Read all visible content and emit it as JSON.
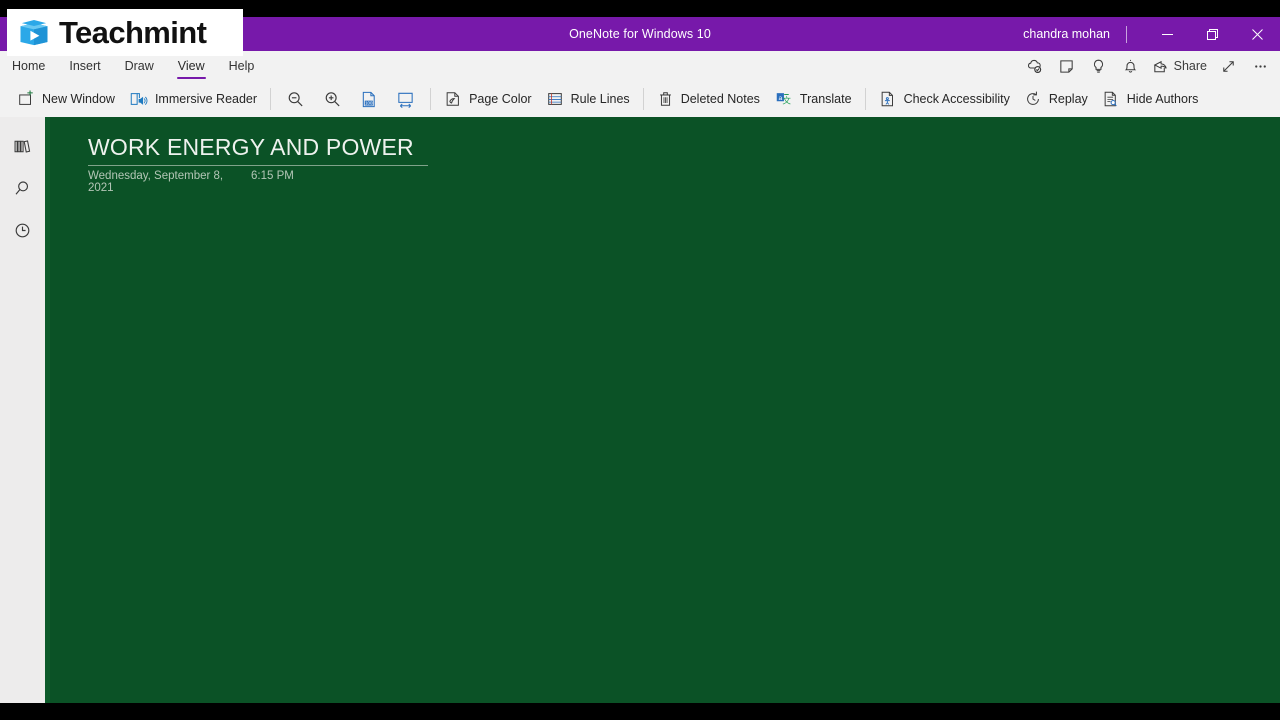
{
  "window": {
    "title": "OneNote for Windows 10",
    "account": "chandra mohan",
    "controls": [
      {
        "name": "minimize-button",
        "label": "Minimize"
      },
      {
        "name": "restore-button",
        "label": "Restore Down"
      },
      {
        "name": "close-button",
        "label": "Close"
      }
    ]
  },
  "watermark": {
    "brand": "Teachmint",
    "logo_icon": "open-book-play-icon",
    "logo_color": "#2BA8E8"
  },
  "ribbon": {
    "tabs": [
      {
        "label": "Home",
        "active": false
      },
      {
        "label": "Insert",
        "active": false
      },
      {
        "label": "Draw",
        "active": false
      },
      {
        "label": "View",
        "active": true
      },
      {
        "label": "Help",
        "active": false
      }
    ],
    "active_tab": "View",
    "accent_color": "#7719AA",
    "quick_actions": [
      {
        "label": "",
        "icon": "cloud-sync-icon"
      },
      {
        "label": "",
        "icon": "sticky-note-icon"
      },
      {
        "label": "",
        "icon": "lightbulb-icon"
      },
      {
        "label": "",
        "icon": "bell-icon"
      },
      {
        "label": "Share",
        "icon": "share-icon"
      },
      {
        "label": "",
        "icon": "expand-arrows-icon"
      },
      {
        "label": "",
        "icon": "ellipsis-icon"
      }
    ],
    "share_label": "Share",
    "tools": [
      {
        "label": "New Window",
        "icon": "new-window-icon"
      },
      {
        "label": "Immersive Reader",
        "icon": "immersive-reader-icon"
      },
      {
        "label": "",
        "icon": "zoom-out-icon"
      },
      {
        "label": "",
        "icon": "zoom-in-icon"
      },
      {
        "label": "",
        "icon": "zoom-100-icon"
      },
      {
        "label": "",
        "icon": "page-width-icon"
      },
      {
        "label": "Page Color",
        "icon": "page-color-icon"
      },
      {
        "label": "Rule Lines",
        "icon": "rule-lines-icon"
      },
      {
        "label": "Deleted Notes",
        "icon": "trash-icon"
      },
      {
        "label": "Translate",
        "icon": "translate-icon"
      },
      {
        "label": "Check Accessibility",
        "icon": "accessibility-icon"
      },
      {
        "label": "Replay",
        "icon": "replay-clock-icon"
      },
      {
        "label": "Hide Authors",
        "icon": "hide-authors-icon"
      }
    ]
  },
  "rail": {
    "items": [
      {
        "label": "Notebooks",
        "icon": "notebooks-icon"
      },
      {
        "label": "Search",
        "icon": "search-icon"
      },
      {
        "label": "Recent Notes",
        "icon": "clock-icon"
      }
    ]
  },
  "page": {
    "title": "WORK ENERGY AND POWER",
    "date": "Wednesday, September 8, 2021",
    "time": "6:15 PM",
    "background_color": "#0B5226",
    "title_color": "#EEF2EE",
    "meta_color": "#B3C6B6"
  }
}
